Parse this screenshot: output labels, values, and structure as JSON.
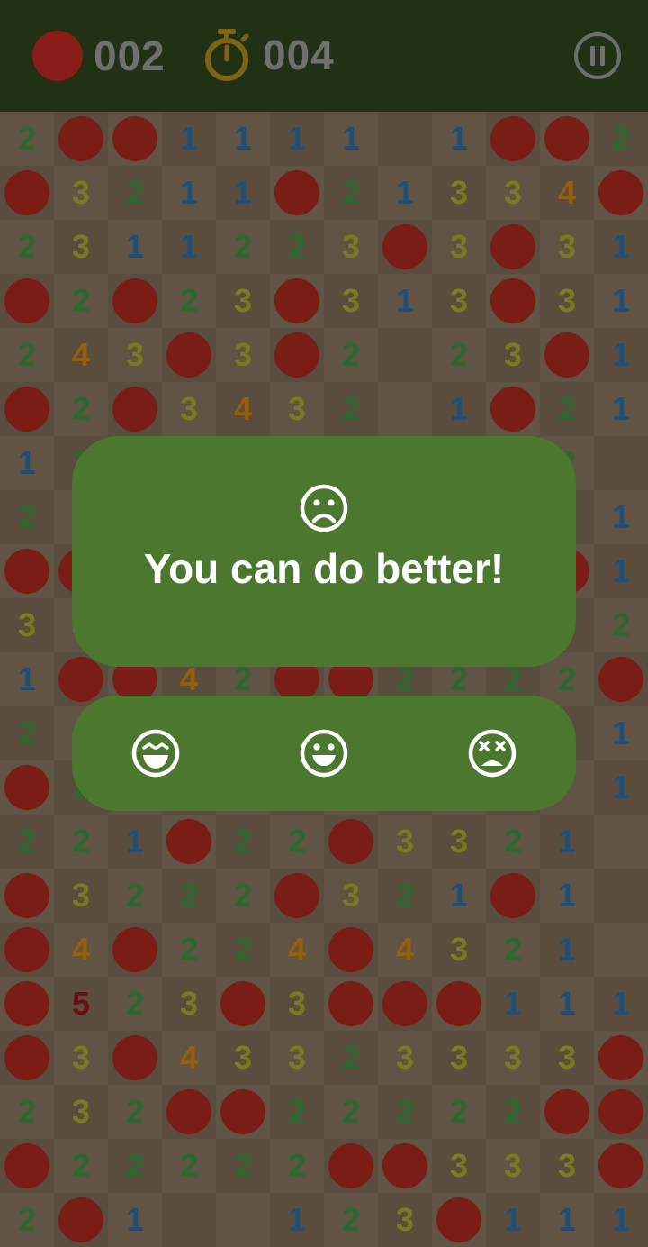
{
  "header": {
    "mines_left": "002",
    "time_elapsed": "004",
    "mine_icon": "mine-icon",
    "timer_icon": "stopwatch-icon",
    "pause_icon": "pause-icon"
  },
  "board": {
    "columns": 12,
    "rows": 21,
    "grid": [
      "2MM1111_1MM2",
      "M3211M2133 4M",
      "231122 3M3M31",
      "M2M23M313M31",
      "243M3M2_23M1",
      "M2M3432_1M21",
      "12________2_",
      "2__________1",
      "MM________M1",
      "33_________2",
      "1MM42MM2222M",
      "22________21",
      "M2_________1",
      "221M22M33 21_",
      "M322 2M321M1_",
      "M4M224M432 1_",
      "M523M3MMM111",
      "M3M433233 33M",
      "232MM22222MM3",
      "M22222MM333M",
      "2M1__123M111"
    ]
  },
  "result": {
    "icon": "sad-face-icon",
    "message": "You can do better!"
  },
  "rating": {
    "options": [
      {
        "icon": "laughing-face-icon"
      },
      {
        "icon": "smiling-face-icon"
      },
      {
        "icon": "dizzy-face-icon"
      }
    ]
  },
  "colors": {
    "header_bg": "#213114",
    "card_bg": "#4b772f",
    "mine": "#7a1d16",
    "num1": "#1d4f7a",
    "num2": "#2b6a2e",
    "num3": "#7c7a1f",
    "num4": "#95600e",
    "num5": "#6b1010"
  }
}
